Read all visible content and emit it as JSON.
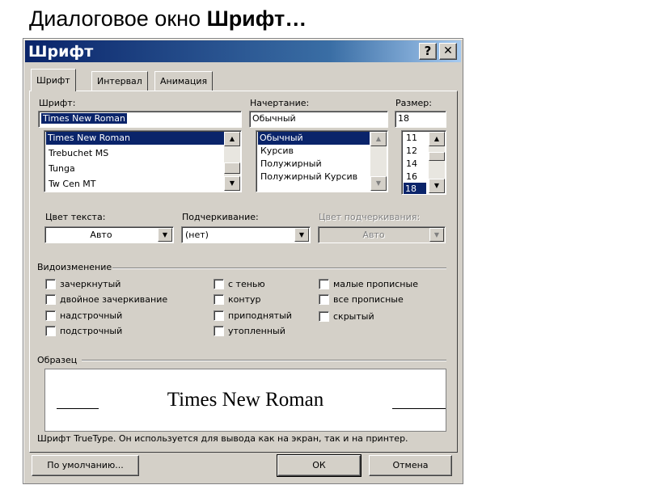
{
  "slide": {
    "title_prefix": "Диалоговое окно ",
    "title_bold": "Шрифт…"
  },
  "dialog": {
    "title": "Шрифт",
    "help_label": "?",
    "close_label": "✕",
    "tabs": [
      {
        "label": "Шрифт",
        "active": true
      },
      {
        "label": "Интервал",
        "active": false
      },
      {
        "label": "Анимация",
        "active": false
      }
    ],
    "font": {
      "label": "Шрифт:",
      "value": "Times New Roman",
      "items": [
        "Times New Roman",
        "Trebuchet MS",
        "Tunga",
        "Tw Cen MT"
      ],
      "selected": "Times New Roman"
    },
    "style": {
      "label": "Начертание:",
      "value": "Обычный",
      "items": [
        "Обычный",
        "Курсив",
        "Полужирный",
        "Полужирный Курсив"
      ],
      "selected": "Обычный"
    },
    "size": {
      "label": "Размер:",
      "value": "18",
      "items": [
        "11",
        "12",
        "14",
        "16",
        "18"
      ],
      "selected": "18"
    },
    "text_color": {
      "label": "Цвет текста:",
      "value": "Авто"
    },
    "underline": {
      "label": "Подчеркивание:",
      "value": "(нет)"
    },
    "underline_color": {
      "label": "Цвет подчеркивания:",
      "value": "Авто",
      "enabled": false
    },
    "effects": {
      "label": "Видоизменение",
      "col1": [
        "зачеркнутый",
        "двойное зачеркивание",
        "надстрочный",
        "подстрочный"
      ],
      "col2": [
        "с тенью",
        "контур",
        "приподнятый",
        "утопленный"
      ],
      "col3": [
        "малые прописные",
        "все прописные",
        "скрытый"
      ],
      "checked": false
    },
    "sample": {
      "label": "Образец",
      "text": "Times New Roman",
      "note": "Шрифт TrueType. Он используется для вывода как на экран, так и на принтер."
    },
    "buttons": {
      "default_label": "По умолчанию...",
      "ok_label": "ОК",
      "cancel_label": "Отмена"
    },
    "colors": {
      "title_bar": "#0a246a",
      "face": "#d4d0c8",
      "selection": "#0a246a"
    },
    "icons": {
      "scroll_up": "up-arrow-icon",
      "scroll_down": "down-arrow-icon",
      "dropdown": "chevron-down-icon"
    }
  }
}
